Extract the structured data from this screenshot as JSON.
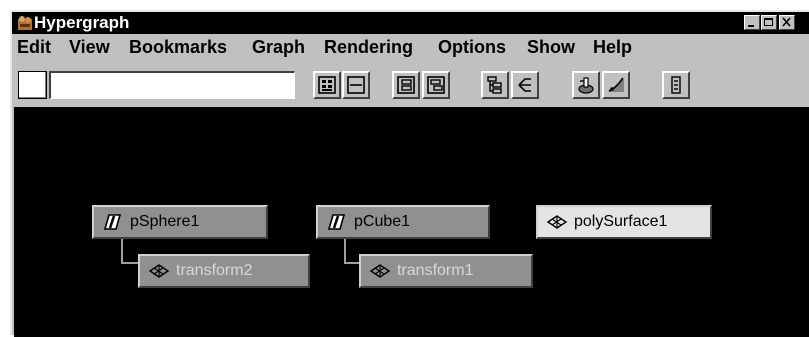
{
  "window": {
    "title": "Hypergraph",
    "controls": {
      "minimize": "_",
      "maximize": "□",
      "close": "×"
    }
  },
  "menubar": {
    "items": [
      {
        "label": "Edit"
      },
      {
        "label": "View"
      },
      {
        "label": "Bookmarks"
      },
      {
        "label": "Graph"
      },
      {
        "label": "Rendering"
      },
      {
        "label": "Options"
      },
      {
        "label": "Show"
      },
      {
        "label": "Help"
      }
    ]
  },
  "toolbar": {
    "search_value": "",
    "buttons": [
      {
        "icon": "scene-hierarchy-icon"
      },
      {
        "icon": "frame-all-icon"
      },
      {
        "icon": "frame-selection-icon"
      },
      {
        "icon": "frame-hierarchy-icon"
      },
      {
        "icon": "horizontal-layout-icon"
      },
      {
        "icon": "vertical-layout-icon"
      },
      {
        "icon": "add-bookmark-icon"
      },
      {
        "icon": "graph-editor-icon"
      },
      {
        "icon": "input-output-icon"
      }
    ]
  },
  "graph": {
    "nodes": [
      {
        "label": "pSphere1",
        "kind": "transform",
        "icon": "transform-node-icon"
      },
      {
        "label": "transform2",
        "kind": "shape",
        "icon": "mesh-shape-icon"
      },
      {
        "label": "pCube1",
        "kind": "transform",
        "icon": "transform-node-icon"
      },
      {
        "label": "transform1",
        "kind": "shape",
        "icon": "mesh-shape-icon"
      },
      {
        "label": "polySurface1",
        "kind": "shape",
        "icon": "mesh-shape-icon",
        "selected": true
      }
    ]
  }
}
